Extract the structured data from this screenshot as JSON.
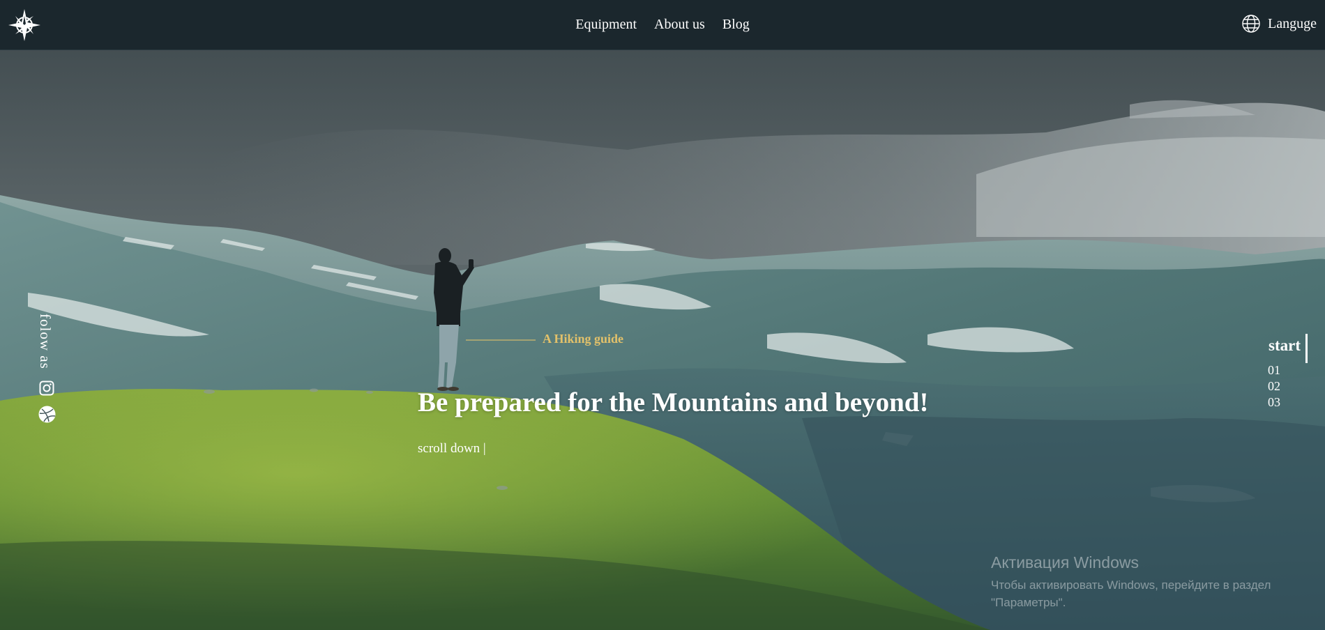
{
  "header": {
    "logo_icon": "compass-star-icon",
    "nav": [
      {
        "label": "Equipment"
      },
      {
        "label": "About us"
      },
      {
        "label": "Blog"
      }
    ],
    "language": {
      "label": "Languge",
      "icon": "globe-icon"
    }
  },
  "social": {
    "label": "folow as",
    "icons": [
      "instagram-icon",
      "dribbble-icon"
    ]
  },
  "hero": {
    "kicker": "A Hiking guide",
    "headline": "Be prepared for the Mountains and beyond!",
    "scroll_label": "scroll down |"
  },
  "pager": {
    "title": "start",
    "items": [
      "01",
      "02",
      "03"
    ]
  },
  "watermark": {
    "title": "Активация Windows",
    "line1": "Чтобы активировать Windows, перейдите в раздел",
    "line2": "\"Параметры\"."
  },
  "colors": {
    "header_bg": "#1b272d",
    "accent": "#e2c16a",
    "text": "#ffffff"
  }
}
